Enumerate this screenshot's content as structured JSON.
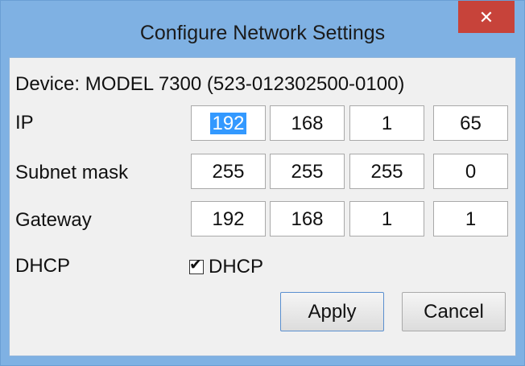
{
  "window": {
    "title": "Configure Network Settings",
    "close_glyph": "✕"
  },
  "device": {
    "label": "Device: MODEL 7300 (523-012302500-0100)"
  },
  "rows": [
    {
      "label": "IP",
      "octets": [
        "192",
        "168",
        "1",
        "65"
      ]
    },
    {
      "label": "Subnet mask",
      "octets": [
        "255",
        "255",
        "255",
        "0"
      ]
    },
    {
      "label": "Gateway",
      "octets": [
        "192",
        "168",
        "1",
        "1"
      ]
    }
  ],
  "dhcp": {
    "label": "DHCP",
    "checkbox_label": "DHCP",
    "checked": true,
    "check_glyph": "✔"
  },
  "buttons": {
    "apply": "Apply",
    "cancel": "Cancel"
  },
  "colors": {
    "titlebar": "#7fb1e3",
    "close": "#c7433a",
    "selection": "#3399ff"
  }
}
